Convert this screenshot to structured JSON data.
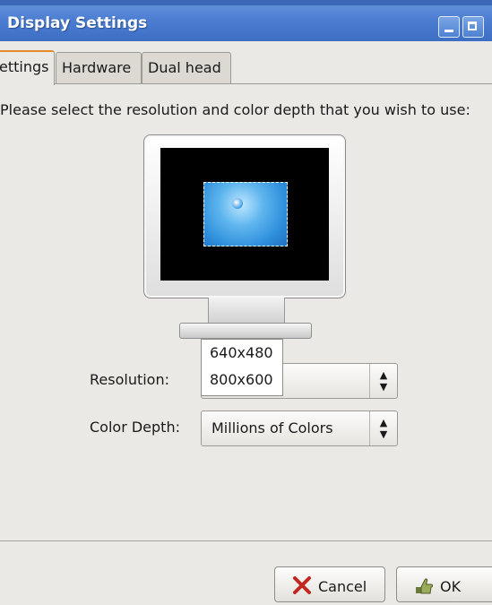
{
  "window": {
    "title": "Display Settings"
  },
  "tabs": [
    {
      "label": "ettings"
    },
    {
      "label": "Hardware"
    },
    {
      "label": "Dual head"
    }
  ],
  "prompt": "Please select the resolution and color depth that you wish to use:",
  "resolution": {
    "label": "Resolution:",
    "options": [
      "640x480",
      "800x600"
    ]
  },
  "color_depth": {
    "label": "Color Depth:",
    "value": "Millions of Colors"
  },
  "buttons": {
    "cancel": "Cancel",
    "ok": "OK"
  },
  "colors": {
    "titlebar": "#4a7cd0",
    "active_tab_accent": "#e48a2d",
    "background": "#ebe9e5"
  },
  "icons": {
    "cancel": "red-x-icon",
    "ok": "hand-ok-icon"
  }
}
